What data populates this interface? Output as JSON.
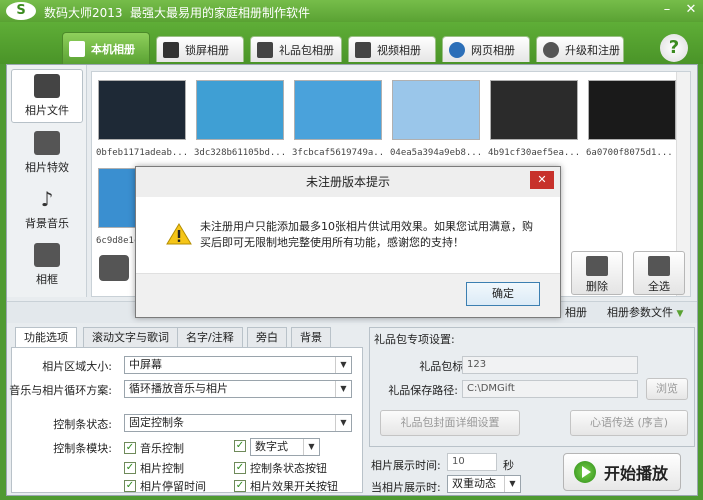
{
  "window": {
    "logo": "S",
    "app_name": "数码大师2013",
    "slogan": "最强大最易用的家庭相册制作软件",
    "minimize": "–",
    "close": "✕"
  },
  "tabs": [
    {
      "label": "本机相册",
      "active": true,
      "icon": "photo-album-icon"
    },
    {
      "label": "锁屏相册",
      "icon": "monitor-icon"
    },
    {
      "label": "礼品包相册",
      "icon": "gift-icon"
    },
    {
      "label": "视频相册",
      "icon": "film-icon"
    },
    {
      "label": "网页相册",
      "icon": "ie-icon"
    },
    {
      "label": "升级和注册",
      "icon": "globe-icon"
    }
  ],
  "help": "?",
  "left_nav": [
    {
      "label": "相片文件",
      "icon": "camera-icon",
      "active": true
    },
    {
      "label": "相片特效",
      "icon": "effects-icon"
    },
    {
      "label": "背景音乐",
      "icon": "music-note-icon"
    },
    {
      "label": "相框",
      "icon": "picture-frame-icon"
    }
  ],
  "thumbnails": [
    {
      "caption": "0bfeb1171adeab...",
      "color": "#1e2936"
    },
    {
      "caption": "3dc328b61105bd...",
      "color": "#3f9fd4"
    },
    {
      "caption": "3fcbcaf5619749a...",
      "color": "#4aa2db"
    },
    {
      "caption": "04ea5a394a9eb8...",
      "color": "#9ac6ea"
    },
    {
      "caption": "4b91cf30aef5ea...",
      "color": "#2b2b2b"
    },
    {
      "caption": "6a0700f8075d1...",
      "color": "#1a1a1a"
    },
    {
      "caption": "6c9d8e1c",
      "color": "#3a8fd0"
    }
  ],
  "toolbar": {
    "delete": "删除",
    "select_all": "全选"
  },
  "strip": {
    "album": "相册",
    "album_params": "相册参数文件",
    "arrow": "▼"
  },
  "settings_tabs": [
    {
      "label": "功能选项",
      "active": true
    },
    {
      "label": "滚动文字与歌词"
    },
    {
      "label": "名字/注释"
    },
    {
      "label": "旁白"
    },
    {
      "label": "背景"
    }
  ],
  "settings": {
    "area_size_label": "相片区域大小:",
    "area_size_value": "中屏幕",
    "loop_label": "音乐与相片循环方案:",
    "loop_value": "循环播放音乐与相片",
    "control_state_label": "控制条状态:",
    "control_state_value": "固定控制条",
    "control_module_label": "控制条模块:",
    "check_music": "音乐控制",
    "check_digital": "数字式",
    "check_photo_ctrl": "相片控制",
    "check_bar_state": "控制条状态按钮",
    "check_dwell": "相片停留时间",
    "check_effect": "相片效果开关按钮",
    "dropdown_arrow": "▼",
    "check_mark": "✓"
  },
  "gift": {
    "header": "礼品包专项设置:",
    "title_label": "礼品包标题:",
    "title_value": "123",
    "path_label": "礼品保存路径:",
    "path_value": "C:\\DMGift",
    "browse": "浏览",
    "cover_btn": "礼品包封面详细设置",
    "heart_btn": "心语传送 (序言)"
  },
  "show_time": {
    "label": "相片展示时间:",
    "value": "10",
    "unit": "秒"
  },
  "current_show": {
    "label": "当相片展示时:",
    "value": "双重动态"
  },
  "start_button": "开始播放",
  "dialog": {
    "title": "未注册版本提示",
    "close": "✕",
    "message": "未注册用户只能添加最多10张相片供试用效果。如果您试用满意，购买后即可无限制地完整使用所有功能，感谢您的支持！",
    "ok": "确定"
  },
  "colors": {
    "brand_green": "#5aa233",
    "dialog_close_red": "#c7312b"
  }
}
